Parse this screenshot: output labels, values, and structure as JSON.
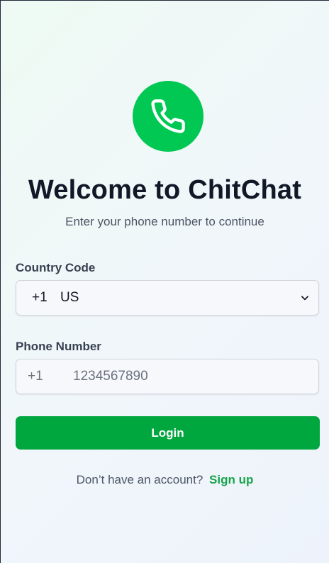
{
  "brand": {
    "logo_icon": "phone-icon",
    "accent_color": "#00c853",
    "button_color": "#00a63e"
  },
  "header": {
    "title": "Welcome to ChitChat",
    "subtitle": "Enter your phone number to continue"
  },
  "form": {
    "country_label": "Country Code",
    "country_select": {
      "code": "+1",
      "country": "US",
      "icon": "chevron-down-icon"
    },
    "phone_label": "Phone Number",
    "phone_prefix": "+1",
    "phone_placeholder": "1234567890",
    "phone_value": ""
  },
  "actions": {
    "login_label": "Login"
  },
  "footer": {
    "prompt": "Don’t have an account?",
    "signup_label": "Sign up"
  }
}
